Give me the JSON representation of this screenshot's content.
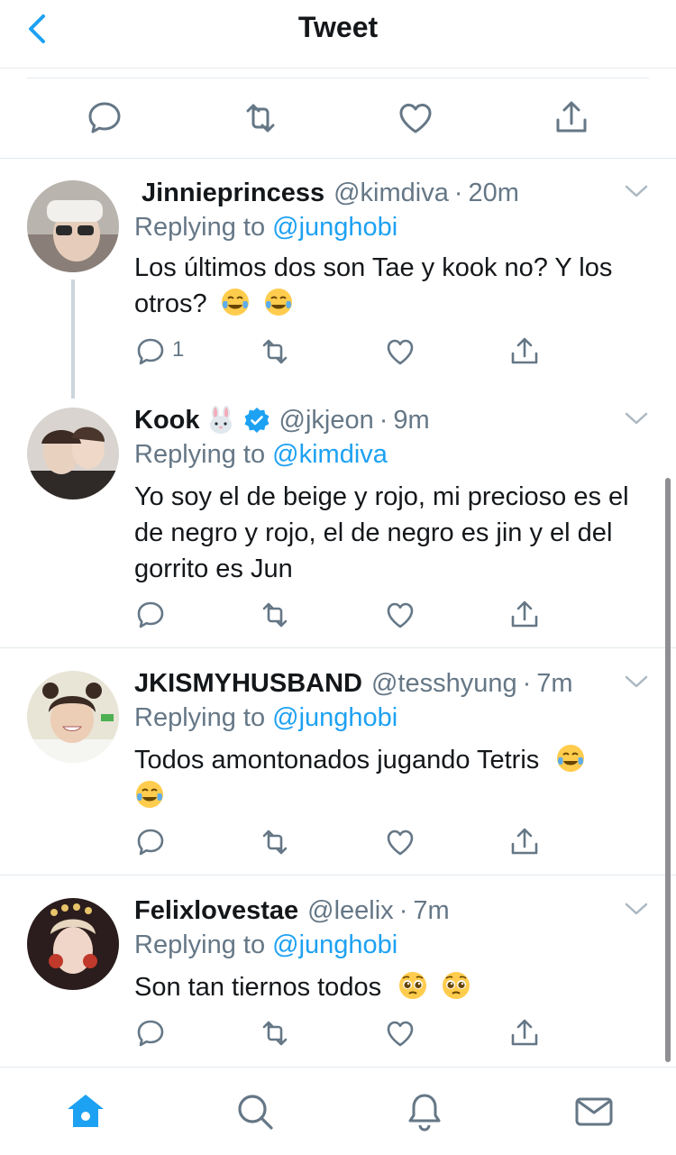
{
  "header": {
    "title": "Tweet",
    "back_label": "back"
  },
  "colors": {
    "accent": "#1da1f2",
    "muted": "#657786",
    "text": "#14171a",
    "divider": "#e1e8ed"
  },
  "tweets": [
    {
      "name": "Jinnieprincess",
      "handle": "@kimdiva",
      "time": "20m",
      "reply_prefix": "Replying to ",
      "reply_to": "@junghobi",
      "text": "Los últimos dos son Tae y kook no? Y los otros?",
      "emoji": [
        "face-with-tears-of-joy",
        "face-with-tears-of-joy"
      ],
      "reply_count": "1"
    },
    {
      "name": "Kook",
      "name_emoji": "rabbit-face",
      "verified": true,
      "handle": "@jkjeon",
      "time": "9m",
      "reply_prefix": "Replying to ",
      "reply_to": "@kimdiva",
      "text": "Yo soy el de beige y rojo, mi precioso es el de negro y rojo, el de negro es jin y el del gorrito es Jun"
    },
    {
      "name": "JKISMYHUSBAND",
      "handle": "@tesshyung",
      "time": "7m",
      "reply_prefix": "Replying to ",
      "reply_to": "@junghobi",
      "text": "Todos amontonados jugando Tetris",
      "emoji": [
        "face-with-tears-of-joy",
        "face-with-tears-of-joy"
      ]
    },
    {
      "name": "Felixlovestae",
      "handle": "@leelix",
      "time": "7m",
      "reply_prefix": "Replying to ",
      "reply_to": "@junghobi",
      "text": "Son tan tiernos todos",
      "emoji": [
        "pleading-face",
        "pleading-face"
      ]
    }
  ],
  "tabbar": {
    "items": [
      "home-icon",
      "search-icon",
      "notifications-icon",
      "messages-icon"
    ],
    "active": "home-icon"
  }
}
